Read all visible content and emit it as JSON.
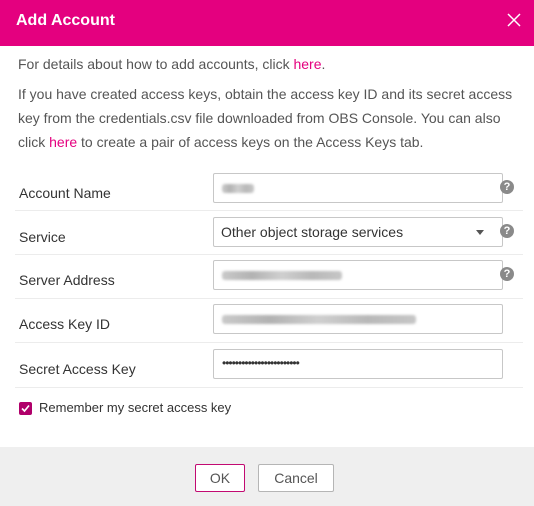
{
  "dialog": {
    "title": "Add Account",
    "accent_color": "#e4007f",
    "close_icon": "close-icon"
  },
  "info": {
    "line1_prefix": "For details about how to add accounts, click ",
    "line1_link": "here",
    "line1_suffix": ".",
    "line2_prefix": "If you have created access keys, obtain the access key ID and its secret access key from the credentials.csv file downloaded from OBS Console. You can also click ",
    "line2_link": "here",
    "line2_suffix": " to create a pair of access keys on the Access Keys tab."
  },
  "form": {
    "account_name": {
      "label": "Account Name",
      "help_icon": "question-icon"
    },
    "service": {
      "label": "Service",
      "value": "Other object storage services",
      "help_icon": "question-icon"
    },
    "server_address": {
      "label": "Server Address",
      "help_icon": "question-icon"
    },
    "access_key_id": {
      "label": "Access Key ID"
    },
    "secret_access_key": {
      "label": "Secret Access Key",
      "value": "••••••••••••••••••••••••"
    }
  },
  "remember": {
    "label": "Remember my secret access key",
    "checked": true
  },
  "footer": {
    "ok_label": "OK",
    "cancel_label": "Cancel"
  }
}
